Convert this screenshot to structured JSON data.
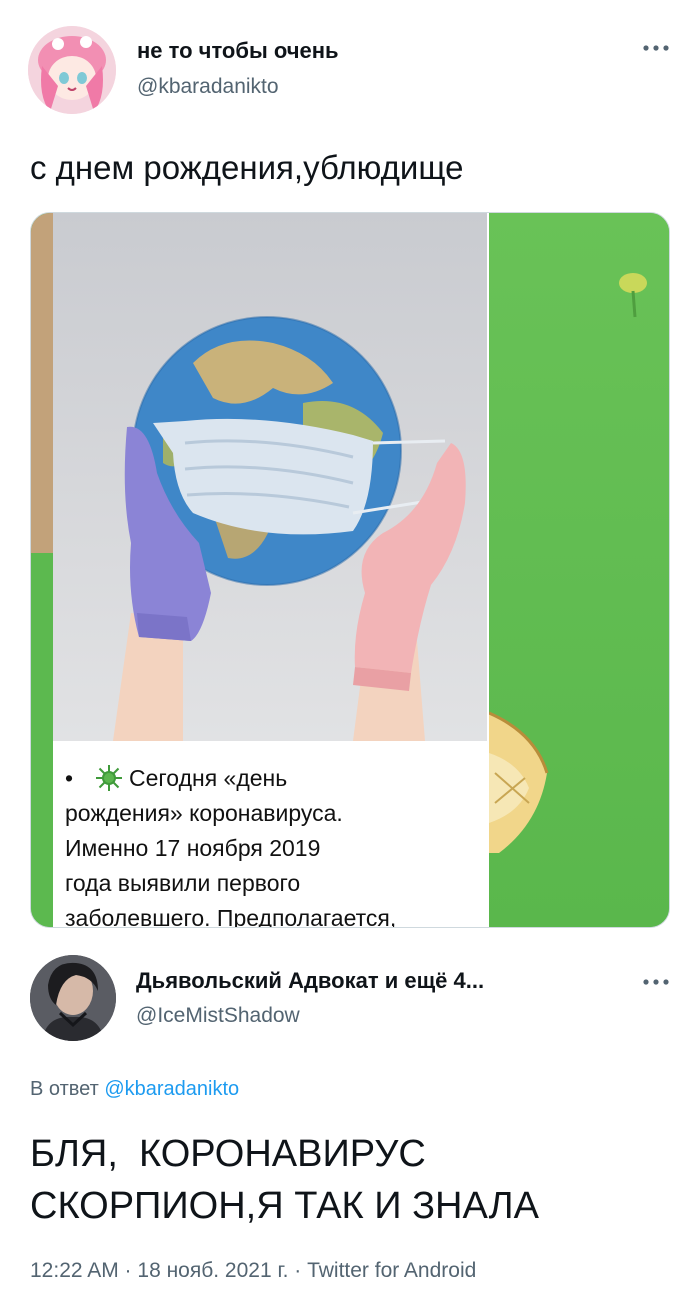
{
  "tweet": {
    "author": {
      "display_name": "не то чтобы очень",
      "handle": "@kbaradanikto"
    },
    "text": "с днем рождения,ублюдище",
    "media": {
      "caption_lines": [
        "Сегодня «день",
        "рождения» коронавируса.",
        "Именно 17 ноября 2019",
        "года выявили первого",
        "заболевшего. Предполагается,"
      ],
      "caption_bullet": "•"
    },
    "more_icon": "more-horizontal-icon"
  },
  "reply": {
    "author": {
      "display_name": "Дьявольский Адвокат и ещё 4...",
      "handle": "@IceMistShadow"
    },
    "reply_to_prefix": "В ответ",
    "reply_to_mention": "@kbaradanikto",
    "text_lines": [
      "БЛЯ,  КОРОНАВИРУС",
      "СКОРПИОН,Я ТАК И ЗНАЛА"
    ],
    "meta": "12:22 AM · 18 нояб. 2021 г. · Twitter for Android",
    "more_icon": "more-horizontal-icon"
  },
  "colors": {
    "text_primary": "#0f1419",
    "text_secondary": "#536471",
    "link": "#1d9bf0",
    "media_green": "#5ab74c"
  }
}
